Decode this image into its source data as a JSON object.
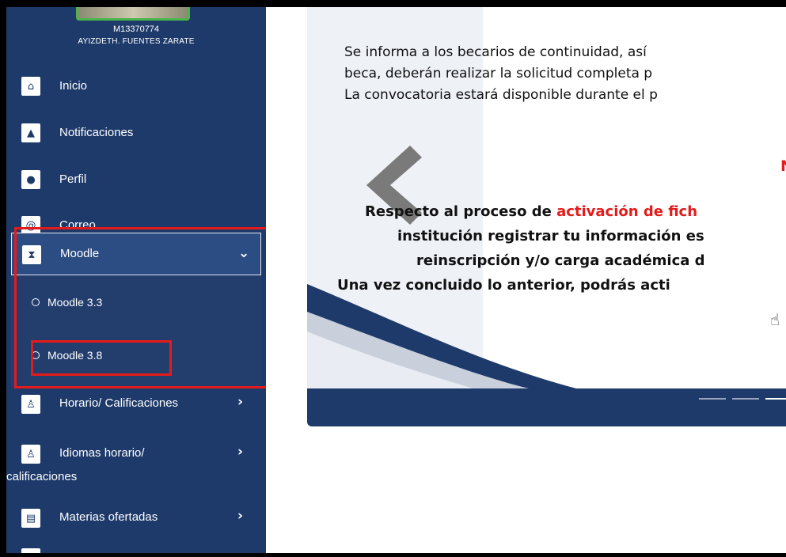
{
  "user": {
    "id": "M13370774",
    "name": "AYIZDETH. FUENTES ZARATE"
  },
  "sidebar": {
    "items": [
      {
        "label": "Inicio",
        "icon": "home-icon"
      },
      {
        "label": "Notificaciones",
        "icon": "bell-icon"
      },
      {
        "label": "Perfil",
        "icon": "user-icon"
      },
      {
        "label": "Correo",
        "icon": "at-icon"
      },
      {
        "label": "Moodle",
        "icon": "hourglass-icon",
        "expanded": true
      },
      {
        "label": "Horario/ Calificaciones",
        "icon": "award-icon"
      },
      {
        "label": "Idiomas horario/",
        "label2": "calificaciones",
        "icon": "award-icon"
      },
      {
        "label": "Materias ofertadas",
        "icon": "clipboard-icon"
      }
    ],
    "moodle_submenu": [
      {
        "label": "Moodle 3.3"
      },
      {
        "label": "Moodle 3.8"
      }
    ]
  },
  "slide": {
    "lines": [
      "Se informa a los becarios de continuidad, así",
      "beca, deberán realizar la solicitud completa p",
      "La convocatoria estará disponible durante el p"
    ],
    "red_letter": "N",
    "bold_1_pre": "Respecto al proceso de ",
    "bold_1_hl": "activación de fich",
    "bold_2": "institución registrar tu información es",
    "bold_3": "reinscripción y/o carga académica d",
    "bold_4": "Una vez concluido lo anterior, podrás acti"
  },
  "colors": {
    "sidebar_bg": "#1e3a6a",
    "highlight_red": "#e31b1b",
    "white": "#ffffff"
  }
}
